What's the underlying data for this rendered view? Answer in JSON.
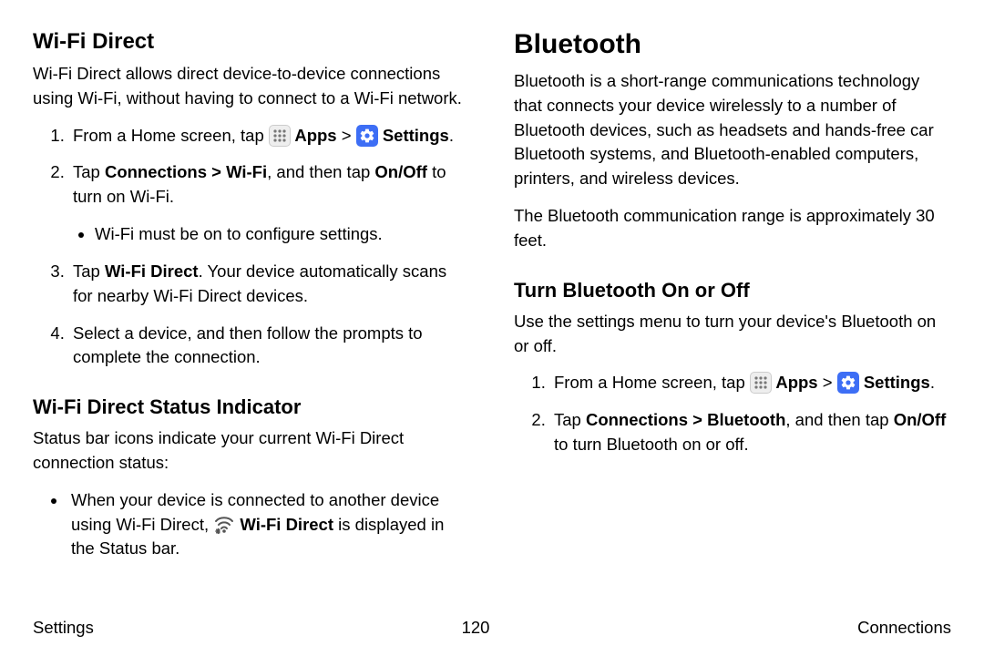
{
  "left": {
    "h2_wifi_direct": "Wi-Fi Direct",
    "p_wifi_direct_intro": "Wi-Fi Direct allows direct device-to-device connections using Wi-Fi, without having to connect to a Wi-Fi network.",
    "step1_a": "From a Home screen, tap ",
    "step1_apps": " Apps",
    "step1_gt": " > ",
    "step1_settings": " Settings",
    "step1_end": ".",
    "step2_a": "Tap ",
    "step2_b": "Connections > Wi-Fi",
    "step2_c": ", and then tap ",
    "step2_d": "On/Off",
    "step2_e": " to turn on Wi-Fi.",
    "step2_bullet": "Wi-Fi must be on to configure settings.",
    "step3_a": "Tap ",
    "step3_b": "Wi-Fi Direct",
    "step3_c": ". Your device automatically scans for nearby Wi-Fi Direct devices.",
    "step4": "Select a device, and then follow the prompts to complete the connection.",
    "h3_status": "Wi-Fi Direct Status Indicator",
    "p_status": "Status bar icons indicate your current Wi-Fi Direct connection status:",
    "bullet_a": "When your device is connected to another device using Wi-Fi Direct, ",
    "bullet_b": " Wi-Fi Direct",
    "bullet_c": " is displayed in the Status bar."
  },
  "right": {
    "h1_bluetooth": "Bluetooth",
    "p_bt_intro": "Bluetooth is a short-range communications technology that connects your device wirelessly to a number of Bluetooth devices, such as headsets and hands-free car Bluetooth systems, and Bluetooth-enabled computers, printers, and wireless devices.",
    "p_bt_range": "The Bluetooth communication range is approximately 30 feet.",
    "h3_turn": "Turn Bluetooth On or Off",
    "p_turn_intro": "Use the settings menu to turn your device's Bluetooth on or off.",
    "step1_a": "From a Home screen, tap ",
    "step1_apps": " Apps",
    "step1_gt": " > ",
    "step1_settings": " Settings",
    "step1_end": ".",
    "step2_a": "Tap ",
    "step2_b": "Connections > Bluetooth",
    "step2_c": ", and then tap ",
    "step2_d": "On/Off",
    "step2_e": " to turn Bluetooth on or off."
  },
  "footer": {
    "left": "Settings",
    "center": "120",
    "right": "Connections"
  }
}
